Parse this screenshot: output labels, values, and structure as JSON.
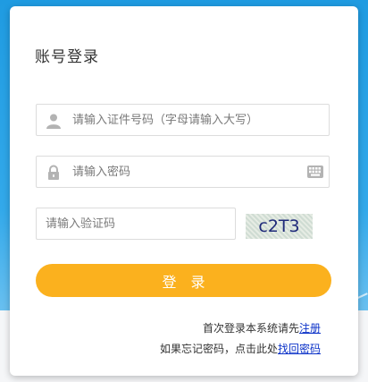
{
  "title": "账号登录",
  "username": {
    "placeholder": "请输入证件号码（字母请输入大写）",
    "value": "",
    "icon": "user-icon"
  },
  "password": {
    "placeholder": "请输入密码",
    "value": "",
    "icon": "lock-icon",
    "keyboard_icon": "keyboard-icon"
  },
  "captcha": {
    "placeholder": "请输入验证码",
    "value": "",
    "image_text": "c2T3"
  },
  "login_button": "登录",
  "register": {
    "prefix": "首次登录本系统请先",
    "link": "注册"
  },
  "forgot": {
    "prefix": "如果忘记密码，点击此处",
    "link": "找回密码"
  },
  "colors": {
    "accent": "#fbb11e",
    "link": "#0b32c8",
    "background": "#2aa3e6"
  }
}
